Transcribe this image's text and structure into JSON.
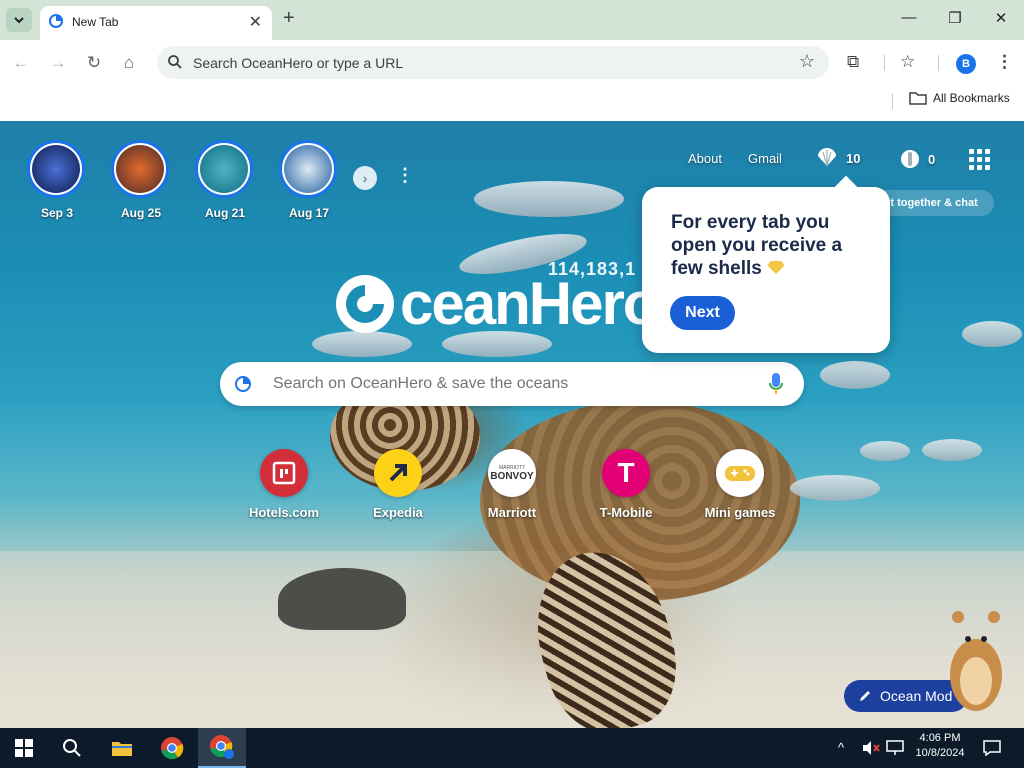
{
  "browser": {
    "tab_title": "New Tab",
    "omnibox_placeholder": "Search OceanHero or type a URL",
    "bookmarks_all": "All Bookmarks",
    "profile_initial": "B"
  },
  "stories": [
    {
      "label": "Sep 3"
    },
    {
      "label": "Aug 25"
    },
    {
      "label": "Aug 21"
    },
    {
      "label": "Aug 17"
    }
  ],
  "header": {
    "about": "About",
    "gmail": "Gmail",
    "shells_count": "10",
    "bottles_count": "0",
    "connect_text": "ct together & chat"
  },
  "hero": {
    "global_counter": "114,183,1",
    "logo_text": "ceanHero"
  },
  "search": {
    "placeholder": "Search on OceanHero & save the oceans"
  },
  "shortcuts": [
    {
      "label": "Hotels.com",
      "color": "#d32f3a"
    },
    {
      "label": "Expedia",
      "color": "#fcd116"
    },
    {
      "label": "Marriott",
      "color": "#ffffff",
      "logo_text_top": "MARRIOTT",
      "logo_text": "BONVOY"
    },
    {
      "label": "T-Mobile",
      "color": "#e20074",
      "logo_text": "T"
    },
    {
      "label": "Mini games",
      "color": "#ffffff"
    }
  ],
  "tooltip": {
    "text": "For every tab you open you receive a few shells",
    "button": "Next"
  },
  "ocean_mode": {
    "label": "Ocean Mod"
  },
  "taskbar": {
    "time": "4:06 PM",
    "date": "10/8/2024"
  },
  "colors": {
    "accent": "#1a73e8",
    "tooltip_button": "#1a5fd8",
    "ocean_mode_button": "#1d3f9e"
  }
}
